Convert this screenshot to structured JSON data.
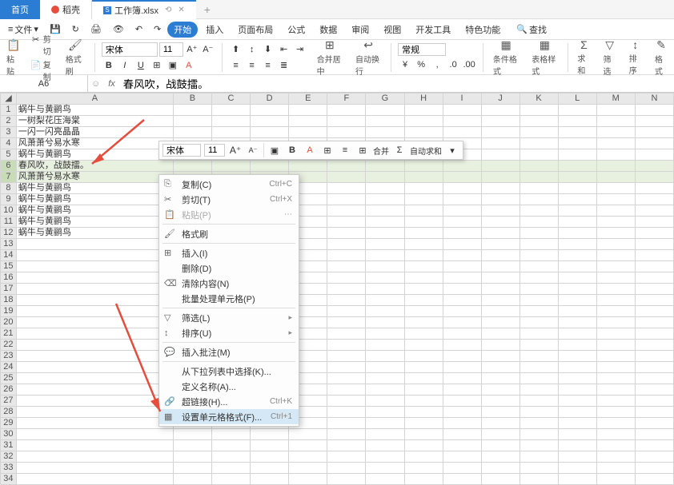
{
  "tabs": {
    "home": "首页",
    "second": "稻壳",
    "file": "工作簿.xlsx"
  },
  "menu": {
    "file": "文件",
    "start": "开始",
    "insert": "插入",
    "pagelayout": "页面布局",
    "formula": "公式",
    "data": "数据",
    "review": "审阅",
    "view": "视图",
    "dev": "开发工具",
    "special": "特色功能",
    "search": "查找"
  },
  "ribbon": {
    "cut": "剪切",
    "paste": "粘贴",
    "copy": "复制",
    "fmtpaint": "格式刷",
    "font": "宋体",
    "size": "11",
    "merge": "合并居中",
    "wrap": "自动换行",
    "condfmt": "条件格式",
    "tablestyle": "表格样式",
    "sum": "求和",
    "filter": "筛选",
    "sort": "排序",
    "format": "格式"
  },
  "namebox": "A6",
  "formula": "春风吹，战鼓擂。",
  "cols": [
    "A",
    "B",
    "C",
    "D",
    "E",
    "F",
    "G",
    "H",
    "I",
    "J",
    "K",
    "L",
    "M",
    "N"
  ],
  "rows": [
    {
      "n": 1,
      "a": "蜗牛与黄鹂鸟"
    },
    {
      "n": 2,
      "a": "一树梨花压海棠"
    },
    {
      "n": 3,
      "a": "一闪一闪亮晶晶"
    },
    {
      "n": 4,
      "a": "风萧萧兮易水寒"
    },
    {
      "n": 5,
      "a": "蜗牛与黄鹂鸟"
    },
    {
      "n": 6,
      "a": "春风吹，战鼓擂。",
      "sel": true
    },
    {
      "n": 7,
      "a": "风萧萧兮易水寒",
      "sel": true
    },
    {
      "n": 8,
      "a": "蜗牛与黄鹂鸟"
    },
    {
      "n": 9,
      "a": "蜗牛与黄鹂鸟"
    },
    {
      "n": 10,
      "a": "蜗牛与黄鹂鸟"
    },
    {
      "n": 11,
      "a": "蜗牛与黄鹂鸟"
    },
    {
      "n": 12,
      "a": "蜗牛与黄鹂鸟"
    },
    {
      "n": 13,
      "a": ""
    },
    {
      "n": 14,
      "a": ""
    },
    {
      "n": 15,
      "a": ""
    },
    {
      "n": 16,
      "a": ""
    },
    {
      "n": 17,
      "a": ""
    },
    {
      "n": 18,
      "a": ""
    },
    {
      "n": 19,
      "a": ""
    },
    {
      "n": 20,
      "a": ""
    },
    {
      "n": 21,
      "a": ""
    },
    {
      "n": 22,
      "a": ""
    },
    {
      "n": 23,
      "a": ""
    },
    {
      "n": 24,
      "a": ""
    },
    {
      "n": 25,
      "a": ""
    },
    {
      "n": 26,
      "a": ""
    },
    {
      "n": 27,
      "a": ""
    },
    {
      "n": 28,
      "a": ""
    },
    {
      "n": 29,
      "a": ""
    },
    {
      "n": 30,
      "a": ""
    },
    {
      "n": 31,
      "a": ""
    },
    {
      "n": 32,
      "a": ""
    },
    {
      "n": 33,
      "a": ""
    },
    {
      "n": 34,
      "a": ""
    }
  ],
  "mini": {
    "font": "宋体",
    "size": "11",
    "merge": "合并",
    "sum": "自动求和"
  },
  "ctx": {
    "copy": "复制(C)",
    "copy_sc": "Ctrl+C",
    "cut": "剪切(T)",
    "cut_sc": "Ctrl+X",
    "paste": "粘贴(P)",
    "fmtpaint": "格式刷",
    "insert": "插入(I)",
    "delete": "删除(D)",
    "clear": "清除内容(N)",
    "batch": "批量处理单元格(P)",
    "filter": "筛选(L)",
    "sort": "排序(U)",
    "comment": "插入批注(M)",
    "dropdown": "从下拉列表中选择(K)...",
    "define": "定义名称(A)...",
    "link": "超链接(H)...",
    "link_sc": "Ctrl+K",
    "cellfmt": "设置单元格格式(F)...",
    "cellfmt_sc": "Ctrl+1"
  }
}
